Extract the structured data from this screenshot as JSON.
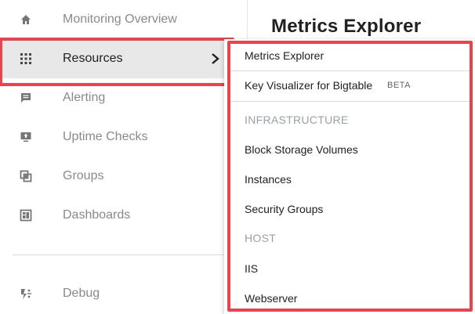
{
  "sidebar": {
    "items": [
      {
        "label": "Monitoring Overview",
        "icon": "home-icon"
      },
      {
        "label": "Resources",
        "icon": "grid-icon"
      },
      {
        "label": "Alerting",
        "icon": "chat-icon"
      },
      {
        "label": "Uptime Checks",
        "icon": "monitor-icon"
      },
      {
        "label": "Groups",
        "icon": "groups-icon"
      },
      {
        "label": "Dashboards",
        "icon": "dashboard-icon"
      }
    ],
    "debug": {
      "label": "Debug",
      "icon": "debug-icon"
    }
  },
  "main": {
    "title": "Metrics Explorer"
  },
  "flyout": {
    "items": [
      {
        "label": "Metrics Explorer"
      },
      {
        "label": "Key Visualizer for Bigtable",
        "badge": "BETA"
      }
    ],
    "infrastructure_header": "INFRASTRUCTURE",
    "infrastructure_items": [
      {
        "label": "Block Storage Volumes"
      },
      {
        "label": "Instances"
      },
      {
        "label": "Security Groups"
      }
    ],
    "host_header": "HOST",
    "host_items": [
      {
        "label": "IIS"
      },
      {
        "label": "Webserver"
      }
    ]
  },
  "colors": {
    "highlight": "#e8444d",
    "active_bg": "#e8e8e8",
    "muted_text": "#8a8a8a"
  }
}
